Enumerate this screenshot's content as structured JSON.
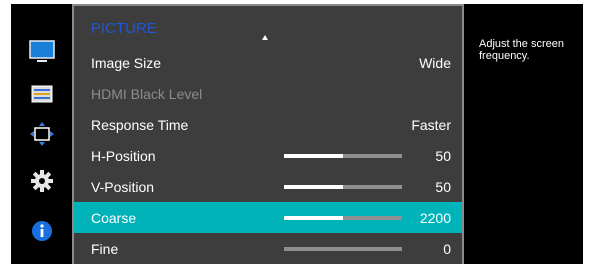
{
  "menu": {
    "title": "PICTURE",
    "items": [
      {
        "label": "Image Size",
        "value": "Wide"
      },
      {
        "label": "HDMI Black Level",
        "value": "",
        "disabled": true
      },
      {
        "label": "Response Time",
        "value": "Faster"
      },
      {
        "label": "H-Position",
        "value": "50",
        "level": 0.5
      },
      {
        "label": "V-Position",
        "value": "50",
        "level": 0.5
      },
      {
        "label": "Coarse",
        "value": "2200",
        "level": 0.5,
        "selected": true
      },
      {
        "label": "Fine",
        "value": "0",
        "level": 0.0
      }
    ]
  },
  "help": {
    "text": "Adjust the screen frequency."
  },
  "sidebar": {
    "icons": [
      "monitor-icon",
      "settings-list-icon",
      "size-position-icon",
      "gear-icon",
      "info-icon"
    ]
  },
  "colors": {
    "title": "#1f57d6",
    "selection": "#00b3b8",
    "panel": "#3d3d3d"
  }
}
